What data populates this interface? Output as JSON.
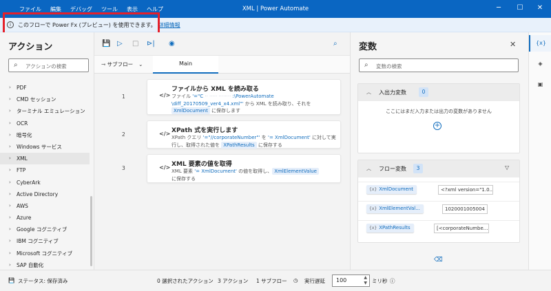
{
  "window": {
    "menu": [
      "ファイル",
      "編集",
      "デバッグ",
      "ツール",
      "表示",
      "ヘルプ"
    ],
    "title": "XML | Power Automate",
    "controls": {
      "minimize": "─",
      "maximize": "☐",
      "close": "✕"
    }
  },
  "banner": {
    "text": "このフローで Power Fx (プレビュー) を使用できます。",
    "link": "詳細情報"
  },
  "actions_pane": {
    "title": "アクション",
    "search_placeholder": "アクションの検索",
    "items": [
      {
        "label": "PDF"
      },
      {
        "label": "CMD セッション"
      },
      {
        "label": "ターミナル エミュレーション"
      },
      {
        "label": "OCR"
      },
      {
        "label": "暗号化"
      },
      {
        "label": "Windows サービス"
      },
      {
        "label": "XML",
        "selected": true
      },
      {
        "label": "FTP"
      },
      {
        "label": "CyberArk"
      },
      {
        "label": "Active Directory"
      },
      {
        "label": "AWS"
      },
      {
        "label": "Azure"
      },
      {
        "label": "Google コグニティブ"
      },
      {
        "label": "IBM コグニティブ"
      },
      {
        "label": "Microsoft コグニティブ"
      },
      {
        "label": "SAP 自動化"
      }
    ]
  },
  "flow": {
    "subflow_label": "サブフロー",
    "main_tab": "Main",
    "steps": [
      {
        "num": "1",
        "title": "ファイルから XML を読み取る",
        "d1": "ファイル ",
        "d2": "'=\"C",
        "d3": ":\\PowerAutomate",
        "d4": "\\diff_20170509_ver4_x4.xml\"'",
        "d5": " から XML を読み取り、それを",
        "d6": "XmlDocument",
        "d7": " に保存します"
      },
      {
        "num": "2",
        "title": "XPath 式を実行します",
        "d1": "XPath クエリ ",
        "d2": "'=\"//corporateNumber\"'",
        "d3": " を ",
        "d4": "'= XmlDocument'",
        "d5": " に対して実行し、取得された値を ",
        "d6": "XPathResults",
        "d7": " に保存する"
      },
      {
        "num": "3",
        "title": "XML 要素の値を取得",
        "d1": "XML 要素 ",
        "d2": "'= XmlDocument'",
        "d3": " の値を取得し、",
        "d4": "XmlElementValue",
        "d5": "に保存する"
      }
    ]
  },
  "variables_pane": {
    "title": "変数",
    "search_placeholder": "変数の検索",
    "io_section": {
      "title": "入出力変数",
      "count": "0",
      "empty_text": "ここにはまだ入力または出力の変数がありません"
    },
    "flow_section": {
      "title": "フロー変数",
      "count": "3",
      "vars": [
        {
          "name": "XmlDocument",
          "value": "<?xml version=\"1.0..."
        },
        {
          "name": "XmlElementVal...",
          "value": "1020001005004"
        },
        {
          "name": "XPathResults",
          "value": "[<corporateNumbe..."
        }
      ]
    }
  },
  "rail": {
    "vars_label": "{x}"
  },
  "status": {
    "state": "ステータス: 保存済み",
    "selected_actions": "0 選択されたアクション",
    "action_count": "3 アクション",
    "subflow_count": "1 サブフロー",
    "delay_label": "実行遅延",
    "delay_value": "100",
    "delay_unit": "ミリ秒"
  }
}
